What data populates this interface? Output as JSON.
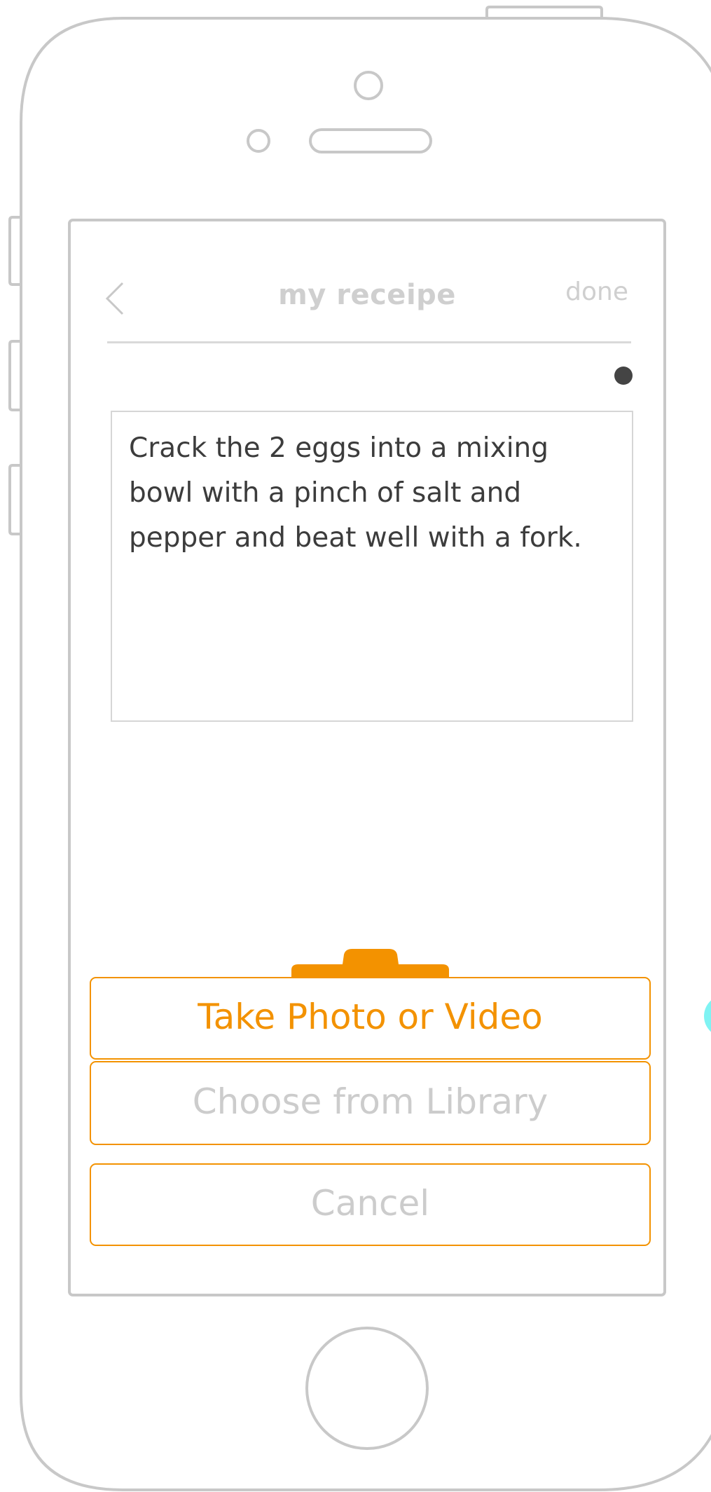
{
  "nav": {
    "title": "my receipe",
    "done_label": "done"
  },
  "editor": {
    "text": "Crack the 2 eggs into a mixing bowl with a pinch of salt and pepper and beat well with a fork."
  },
  "action_sheet": {
    "take_photo_label": "Take Photo or Video",
    "choose_library_label": "Choose from Library",
    "cancel_label": "Cancel"
  },
  "colors": {
    "accent": "#f39200",
    "frame": "#c8c8c8",
    "muted_text": "#cccccc",
    "body_text": "#3c3c3c",
    "dot": "#444444",
    "edge_bubble": "#7ff3f3"
  },
  "icons": {
    "back": "chevron-left-icon",
    "camera_tab": "camera-tab-icon"
  }
}
